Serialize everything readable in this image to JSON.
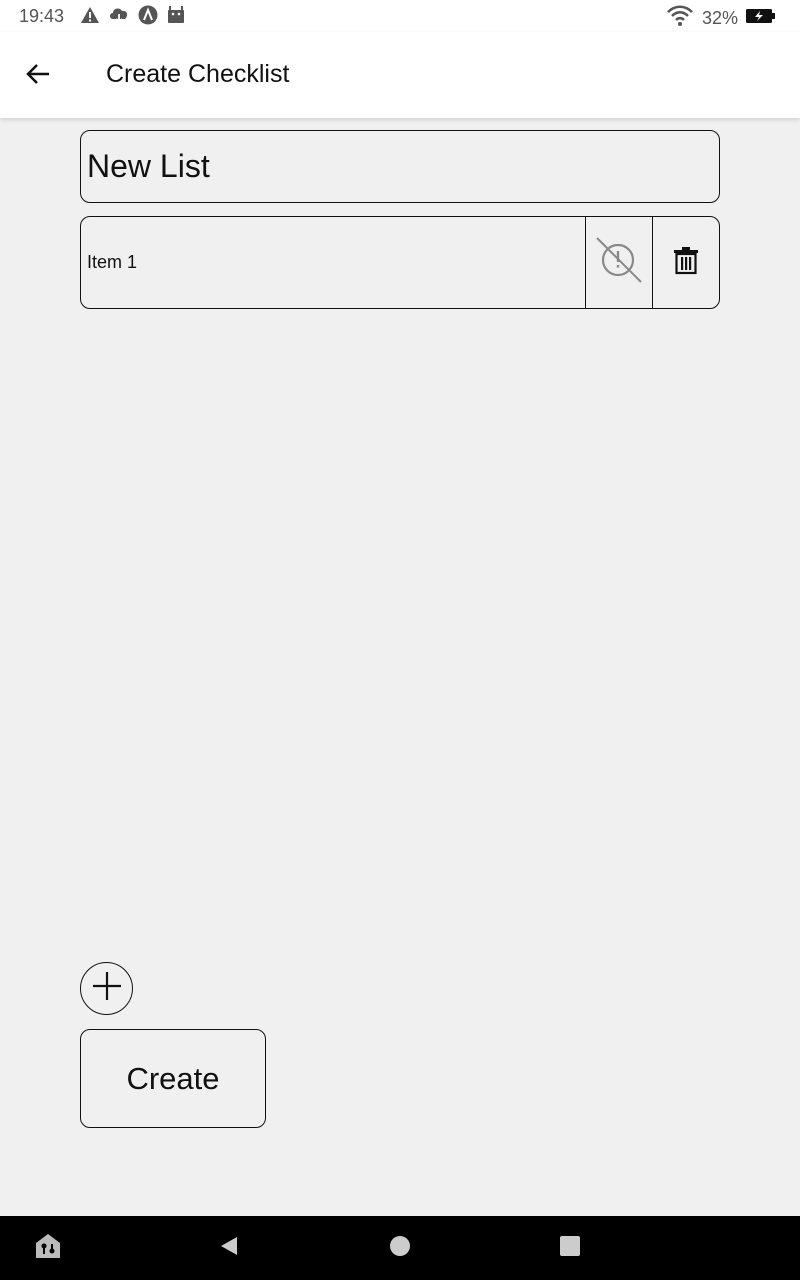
{
  "status_bar": {
    "time": "19:43",
    "battery": "32%",
    "icons_left": [
      "warning-icon",
      "cloud-download-icon",
      "app-logo-icon",
      "android-icon"
    ],
    "icons_right": [
      "wifi-icon",
      "battery-charging-icon"
    ]
  },
  "app_bar": {
    "title": "Create Checklist",
    "back_icon": "arrow-left-icon"
  },
  "form": {
    "list_name_value": "New List",
    "items": [
      {
        "value": "Item 1",
        "priority_icon": "alert-off-icon",
        "delete_icon": "trash-icon"
      }
    ],
    "add_icon": "plus-icon",
    "create_label": "Create"
  },
  "nav_bar": {
    "icons": [
      "assistant-icon",
      "back-triangle-icon",
      "home-circle-icon",
      "recents-square-icon"
    ]
  },
  "colors": {
    "background": "#f0f0f0",
    "app_bar": "#ffffff",
    "border": "#111111",
    "nav_bar": "#000000"
  }
}
